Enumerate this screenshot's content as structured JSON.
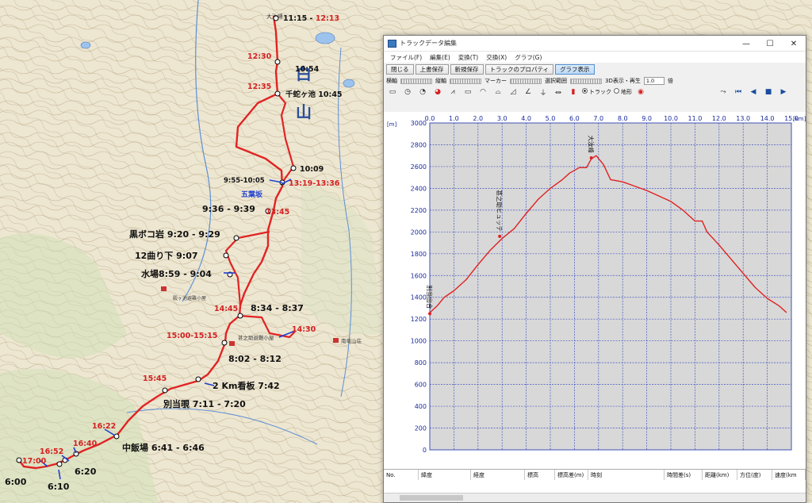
{
  "map": {
    "route_labels": [
      {
        "text": "11:15 - ",
        "red": "12:13"
      },
      {
        "text": "",
        "red": "12:30"
      },
      {
        "text": "10:54",
        "red": ""
      },
      {
        "text": "",
        "red": "12:35"
      },
      {
        "text": "千蛇ヶ池 10:45",
        "red": ""
      },
      {
        "text": "10:09",
        "red": ""
      },
      {
        "text": "9:55-10:05",
        "red": ""
      },
      {
        "text": "",
        "red": "13:19-13:36"
      },
      {
        "text": "五葉坂",
        "red": ""
      },
      {
        "text": "9:36 - 9:39",
        "red": ""
      },
      {
        "text": "",
        "red": "13:45"
      },
      {
        "text": "黒ボコ岩 9:20 - 9:29",
        "red": ""
      },
      {
        "text": "12曲り下 9:07",
        "red": ""
      },
      {
        "text": "水場8:59 - 9:04",
        "red": ""
      },
      {
        "text": "",
        "red": "14:45"
      },
      {
        "text": "8:34 - 8:37",
        "red": ""
      },
      {
        "text": "",
        "red": "14:30"
      },
      {
        "text": "",
        "red": "15:00-15:15"
      },
      {
        "text": "8:02 - 8:12",
        "red": ""
      },
      {
        "text": "",
        "red": "15:45"
      },
      {
        "text": "2 Km看板 7:42",
        "red": ""
      },
      {
        "text": "別当覗 7:11 - 7:20",
        "red": ""
      },
      {
        "text": "",
        "red": "16:22"
      },
      {
        "text": "中飯場 6:41 - 6:46",
        "red": ""
      },
      {
        "text": "",
        "red": "16:40"
      },
      {
        "text": "",
        "red": "16:52"
      },
      {
        "text": "",
        "red": "17:00"
      },
      {
        "text": "6:20",
        "red": ""
      },
      {
        "text": "6:00",
        "red": ""
      },
      {
        "text": "6:10",
        "red": ""
      }
    ],
    "map_text": [
      "白",
      "山",
      "大汝峰",
      "殿ヶ池避難小屋",
      "甚之助避難小屋",
      "南竜山荘"
    ]
  },
  "window": {
    "title": "トラックデータ編集",
    "controls": {
      "minimize": "—",
      "maximize": "☐",
      "close": "✕"
    },
    "menu": [
      "ファイル(F)",
      "編集(E)",
      "変換(T)",
      "交換(X)",
      "グラフ(G)"
    ],
    "toolbar": [
      "閉じる",
      "上書保存",
      "新規保存",
      "トラックのプロパティ",
      "グラフ表示"
    ],
    "toolbar2": {
      "yoko": "横軸",
      "tate": "縦軸",
      "marker": "マーカー",
      "select_range": "選択範囲",
      "view3d": "3D表示・再生",
      "speed": "1.0",
      "speed_unit": "倍"
    },
    "toolbar3": {
      "radio_track": "トラック",
      "radio_terrain": "地形"
    },
    "table_headers": [
      "No.",
      "緯度",
      "経度",
      "標高",
      "標高差(m)",
      "時刻",
      "時間差(s)",
      "距離(km)",
      "方位(度)",
      "速度(km"
    ]
  },
  "chart_data": {
    "type": "line",
    "xlabel": "",
    "ylabel": "[m]",
    "xunit": "[km]",
    "xlim": [
      0,
      15
    ],
    "ylim": [
      0,
      3000
    ],
    "x_ticks": [
      "0.0",
      "1.0",
      "2.0",
      "3.0",
      "4.0",
      "5.0",
      "6.0",
      "7.0",
      "8.0",
      "9.0",
      "10.0",
      "11.0",
      "12.0",
      "13.0",
      "14.0",
      "15.0"
    ],
    "y_ticks": [
      "0",
      "200",
      "400",
      "600",
      "800",
      "1000",
      "1200",
      "1400",
      "1600",
      "1800",
      "2000",
      "2200",
      "2400",
      "2600",
      "2800",
      "3000"
    ],
    "annotations": [
      {
        "text": "別当出合",
        "x": 0.0,
        "y": 1250
      },
      {
        "text": "甚之助ヒュッテ",
        "x": 2.9,
        "y": 1960
      },
      {
        "text": "大汝峰",
        "x": 6.7,
        "y": 2680
      }
    ],
    "series": [
      {
        "x": [
          0.0,
          0.3,
          0.6,
          1.0,
          1.5,
          2.0,
          2.5,
          3.0,
          3.5,
          4.0,
          4.5,
          5.0,
          5.5,
          5.8,
          6.2,
          6.5,
          6.7,
          6.9,
          7.2,
          7.5,
          8.0,
          8.5,
          9.0,
          9.5,
          10.0,
          10.5,
          11.0,
          11.3,
          11.5,
          12.0,
          12.5,
          13.0,
          13.5,
          14.0,
          14.5,
          14.8
        ],
        "y": [
          1260,
          1320,
          1400,
          1460,
          1560,
          1700,
          1830,
          1940,
          2030,
          2170,
          2300,
          2400,
          2480,
          2540,
          2590,
          2590,
          2670,
          2700,
          2620,
          2480,
          2460,
          2420,
          2380,
          2330,
          2280,
          2200,
          2100,
          2100,
          2000,
          1880,
          1750,
          1620,
          1490,
          1390,
          1320,
          1260
        ]
      }
    ]
  }
}
